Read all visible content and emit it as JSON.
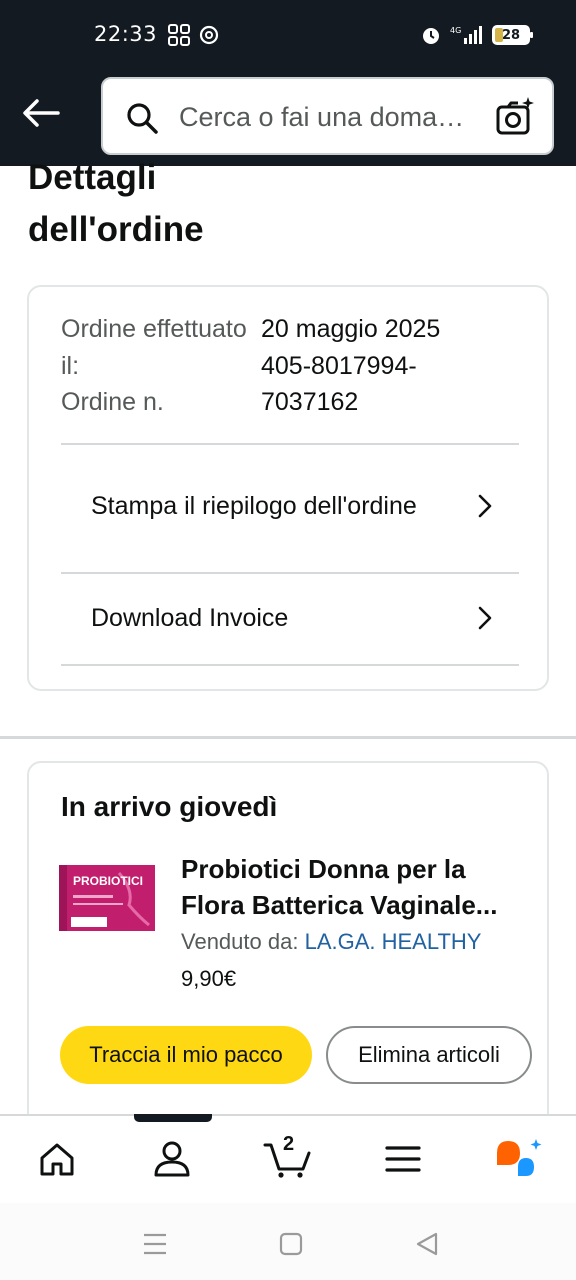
{
  "status_bar": {
    "time": "22:33",
    "battery": "28",
    "network": "4G"
  },
  "header": {
    "search_placeholder": "Cerca o fai una domanda",
    "icons": [
      "back-arrow-icon",
      "search-icon",
      "camera-search-icon"
    ]
  },
  "page": {
    "title": "Dettagli dell'ordine"
  },
  "order_summary": {
    "date_label": "Ordine effettuato il:",
    "date_value": "20 maggio 2025",
    "number_label": "Ordine n.",
    "number_value": "405-8017994-7037162",
    "print_summary_label": "Stampa il riepilogo dell'ordine",
    "download_invoice_label": "Download Invoice"
  },
  "delivery": {
    "title": "In arrivo giovedì",
    "product_name_line1": "Probiotici Donna per la",
    "product_name_line2": "Flora Batterica Vaginale...",
    "seller_label": "Venduto da:",
    "seller_name": "LA.GA. HEALTHY",
    "price": "9,90€",
    "track_button": "Traccia il mio pacco",
    "delete_button": "Elimina articoli",
    "product_image_text": "PROBIOTICI"
  },
  "bottom_nav": {
    "items": [
      "home-icon",
      "account-icon",
      "cart-icon",
      "menu-icon",
      "rufus-icon"
    ],
    "cart_count": "2"
  },
  "colors": {
    "header_bg": "#131a22",
    "track_button": "#ffd814",
    "link": "#2162a1",
    "rufus_orange": "#ff6200",
    "rufus_blue": "#1a98ff"
  }
}
